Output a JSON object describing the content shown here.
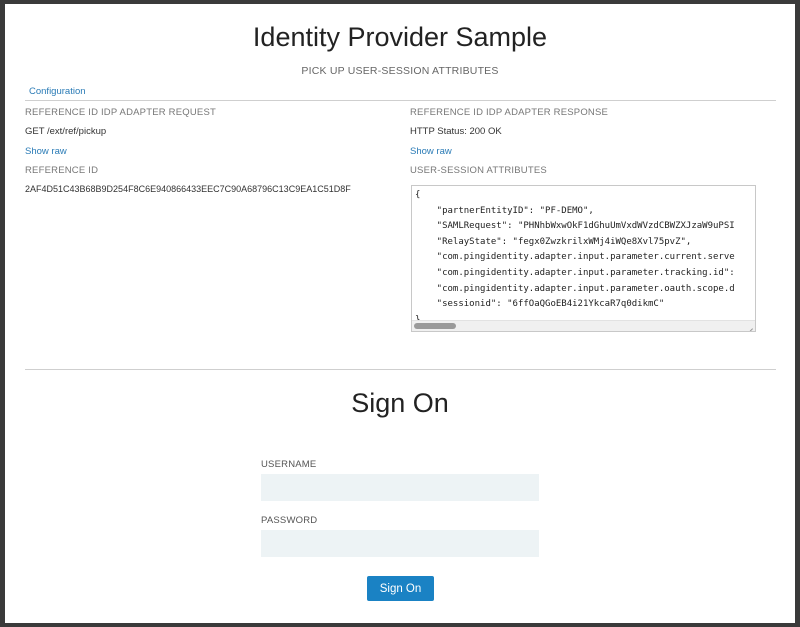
{
  "header": {
    "title": "Identity Provider Sample",
    "subtitle": "PICK UP USER-SESSION ATTRIBUTES"
  },
  "nav": {
    "configuration_link": "Configuration"
  },
  "request": {
    "label": "REFERENCE ID IDP ADAPTER REQUEST",
    "value": "GET /ext/ref/pickup",
    "show_raw": "Show raw"
  },
  "reference": {
    "label": "REFERENCE ID",
    "value": "2AF4D51C43B68B9D254F8C6E940866433EEC7C90A68796C13C9EA1C51D8F"
  },
  "response": {
    "label": "REFERENCE ID IDP ADAPTER RESPONSE",
    "value": "HTTP Status: 200 OK",
    "show_raw": "Show raw"
  },
  "attributes": {
    "label": "USER-SESSION ATTRIBUTES",
    "json": "{\n    \"partnerEntityID\": \"PF-DEMO\",\n    \"SAMLRequest\": \"PHNhbWxwOkF1dGhuUmVxdWVzdCBWZXJzaW9uPSI\n    \"RelayState\": \"fegx0ZwzkrilxWMj4iWQe8Xvl75pvZ\",\n    \"com.pingidentity.adapter.input.parameter.current.serve\n    \"com.pingidentity.adapter.input.parameter.tracking.id\":\n    \"com.pingidentity.adapter.input.parameter.oauth.scope.d\n    \"sessionid\": \"6ffOaQGoEB4i21YkcaR7q0dikmC\"\n}"
  },
  "signon": {
    "title": "Sign On",
    "username_label": "USERNAME",
    "username_value": "",
    "password_label": "PASSWORD",
    "password_value": "",
    "button_label": "Sign On"
  }
}
